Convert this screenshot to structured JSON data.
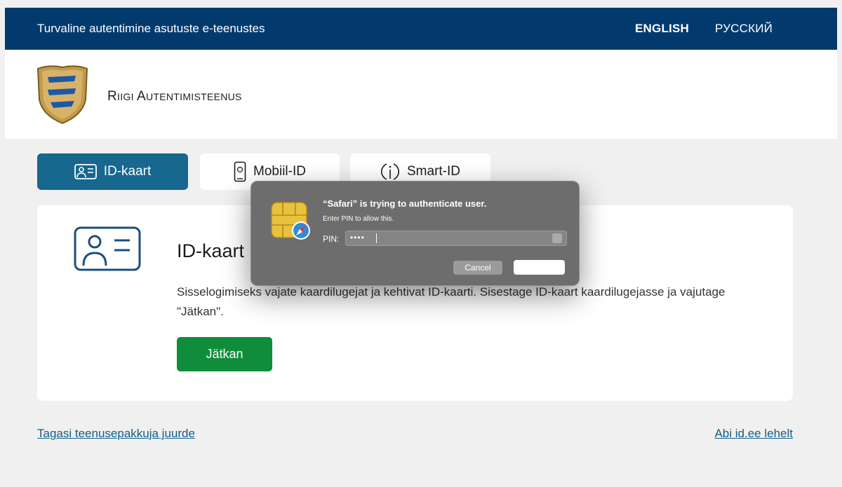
{
  "topbar": {
    "title": "Turvaline autentimine asutuste e-teenustes",
    "lang_english": "ENGLISH",
    "lang_russian": "РУССКИЙ"
  },
  "header": {
    "brand_first": "R",
    "brand_rest_1": "IIGI ",
    "brand_second": "A",
    "brand_rest_2": "UTENTIMISTEENUS"
  },
  "tabs": [
    {
      "label": "ID-kaart",
      "icon": "id-card-icon",
      "active": true
    },
    {
      "label": "Mobiil-ID",
      "icon": "mobile-phone-icon",
      "active": false
    },
    {
      "label": "Smart-ID",
      "icon": "smart-id-icon",
      "active": false
    }
  ],
  "card": {
    "heading": "ID-kaart",
    "description": "Sisselogimiseks vajate kaardilugejat ja kehtivat ID-kaarti. Sisestage ID-kaart kaardilugejasse ja vajutage \"Jätkan\".",
    "continue_label": "Jätkan"
  },
  "footer": {
    "back_link": "Tagasi teenusepakkuja juurde",
    "help_link": "Abi id.ee lehelt"
  },
  "dialog": {
    "title": "“Safari” is trying to authenticate user.",
    "subtitle": "Enter PIN to allow this.",
    "pin_label": "PIN:",
    "pin_value": "••••",
    "cancel_label": "Cancel",
    "ok_label": ""
  },
  "colors": {
    "topbar": "#033a6e",
    "active_tab": "#17678f",
    "continue_button": "#108d3a",
    "link": "#0e5f8a"
  }
}
